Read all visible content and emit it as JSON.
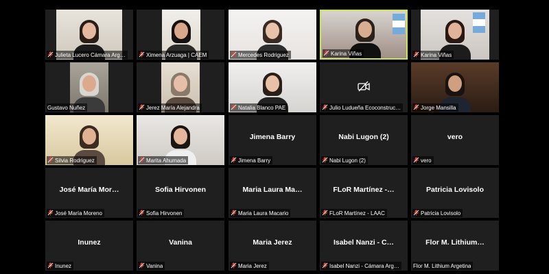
{
  "colors": {
    "tile_bg": "#1f1f1f",
    "active_border": "#c9e35a",
    "muted_mic": "#e0443a"
  },
  "participants": [
    {
      "label": "Julieta Lucero Cámara Arg…",
      "muted": true,
      "video": true
    },
    {
      "label": "Ximena Arzuaga | CAEM",
      "muted": true,
      "video": true
    },
    {
      "label": "Mercedes Rodriguez",
      "muted": true,
      "video": true
    },
    {
      "label": "Karina Viñas",
      "muted": true,
      "video": true,
      "active": true
    },
    {
      "label": "Karina Viñas",
      "muted": true,
      "video": true
    },
    {
      "label": "Gustavo Nuñez",
      "muted": false,
      "video": true
    },
    {
      "label": "Jerez María Alejandra",
      "muted": true,
      "video": true
    },
    {
      "label": "Natalia Blanco PAE",
      "muted": true,
      "video": true
    },
    {
      "label": "Julio Ludueña Ecoconstruc…",
      "muted": true,
      "video": false,
      "camera_off_icon": true
    },
    {
      "label": "Jorge Mansilla",
      "muted": true,
      "video": true
    },
    {
      "label": "Silvia Rodriguez",
      "muted": true,
      "video": true
    },
    {
      "label": "Marita Ahumada",
      "muted": true,
      "video": true
    },
    {
      "label": "Jimena Barry",
      "display": "Jimena Barry",
      "muted": true,
      "video": false
    },
    {
      "label": "Nabi Lugon (2)",
      "display": "Nabi Lugon (2)",
      "muted": true,
      "video": false
    },
    {
      "label": "vero",
      "display": "vero",
      "muted": true,
      "video": false
    },
    {
      "label": "José María Moreno",
      "display": "José María Mor…",
      "muted": true,
      "video": false
    },
    {
      "label": "Sofia Hirvonen",
      "display": "Sofia Hirvonen",
      "muted": true,
      "video": false
    },
    {
      "label": "Maria Laura Macario",
      "display": "Maria Laura Ma…",
      "muted": true,
      "video": false
    },
    {
      "label": "FLoR Martínez - LAAC",
      "display": "FLoR Martínez -…",
      "muted": true,
      "video": false
    },
    {
      "label": "Patricia Lovisolo",
      "display": "Patricia Lovisolo",
      "muted": true,
      "video": false
    },
    {
      "label": "Inunez",
      "display": "Inunez",
      "muted": true,
      "video": false
    },
    {
      "label": "Vanina",
      "display": "Vanina",
      "muted": true,
      "video": false
    },
    {
      "label": "Maria Jerez",
      "display": "Maria Jerez",
      "muted": true,
      "video": false
    },
    {
      "label": "Isabel Nanzi -  Cámara Arg…",
      "display": "Isabel Nanzi -  C…",
      "muted": true,
      "video": false
    },
    {
      "label": "Flor M. Lithium Argetina",
      "display": "Flor M. Lithium…",
      "muted": false,
      "video": false
    }
  ]
}
